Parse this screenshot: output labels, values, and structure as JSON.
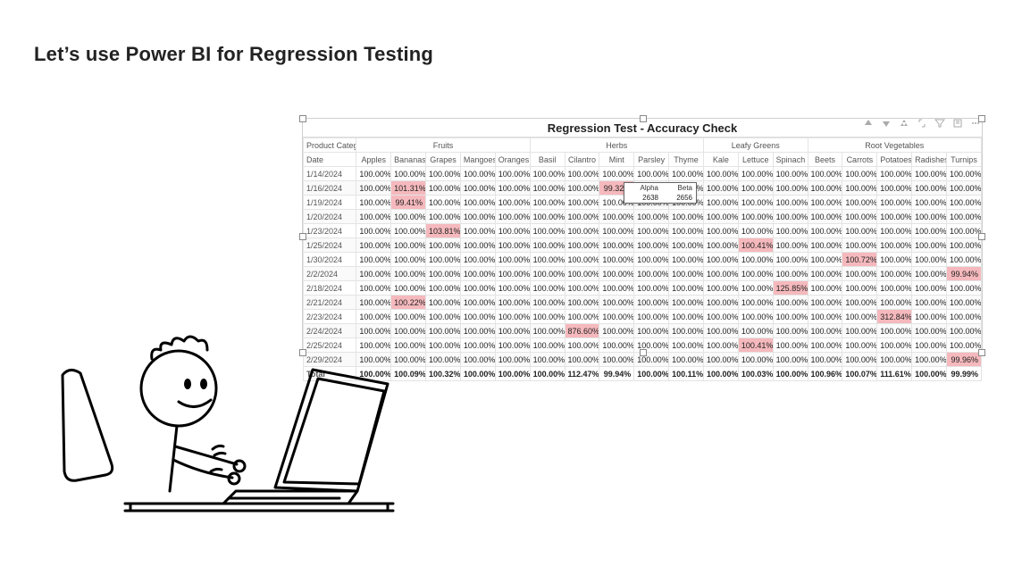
{
  "title": "Let’s use Power BI for Regression Testing",
  "visual": {
    "title": "Regression Test - Accuracy Check",
    "row_label_top": "Product Category",
    "row_label_sub": "Date",
    "groups": [
      {
        "name": "Fruits",
        "span": 5
      },
      {
        "name": "Herbs",
        "span": 5
      },
      {
        "name": "Leafy Greens",
        "span": 3
      },
      {
        "name": "Root Vegetables",
        "span": 5
      }
    ],
    "columns": [
      "Apples",
      "Bananas",
      "Grapes",
      "Mangoes",
      "Oranges",
      "Basil",
      "Cilantro",
      "Mint",
      "Parsley",
      "Thyme",
      "Kale",
      "Lettuce",
      "Spinach",
      "Beets",
      "Carrots",
      "Potatoes",
      "Radishes",
      "Turnips"
    ],
    "rows": [
      {
        "date": "1/14/2024",
        "vals": [
          "100.00%",
          "100.00%",
          "100.00%",
          "100.00%",
          "100.00%",
          "100.00%",
          "100.00%",
          "100.00%",
          "100.00%",
          "100.00%",
          "100.00%",
          "100.00%",
          "100.00%",
          "100.00%",
          "100.00%",
          "100.00%",
          "100.00%",
          "100.00%"
        ],
        "hl": []
      },
      {
        "date": "1/16/2024",
        "vals": [
          "100.00%",
          "101.31%",
          "100.00%",
          "100.00%",
          "100.00%",
          "100.00%",
          "100.00%",
          "99.32%",
          "100.00%",
          "100.00%",
          "100.00%",
          "100.00%",
          "100.00%",
          "100.00%",
          "100.00%",
          "100.00%",
          "100.00%",
          "100.00%"
        ],
        "hl": [
          1,
          7
        ]
      },
      {
        "date": "1/19/2024",
        "vals": [
          "100.00%",
          "99.41%",
          "100.00%",
          "100.00%",
          "100.00%",
          "100.00%",
          "100.00%",
          "100.00%",
          "100.00%",
          "100.00%",
          "100.00%",
          "100.00%",
          "100.00%",
          "100.00%",
          "100.00%",
          "100.00%",
          "100.00%",
          "100.00%"
        ],
        "hl": [
          1
        ]
      },
      {
        "date": "1/20/2024",
        "vals": [
          "100.00%",
          "100.00%",
          "100.00%",
          "100.00%",
          "100.00%",
          "100.00%",
          "100.00%",
          "100.00%",
          "100.00%",
          "100.00%",
          "100.00%",
          "100.00%",
          "100.00%",
          "100.00%",
          "100.00%",
          "100.00%",
          "100.00%",
          "100.00%"
        ],
        "hl": []
      },
      {
        "date": "1/23/2024",
        "vals": [
          "100.00%",
          "100.00%",
          "103.81%",
          "100.00%",
          "100.00%",
          "100.00%",
          "100.00%",
          "100.00%",
          "100.00%",
          "100.00%",
          "100.00%",
          "100.00%",
          "100.00%",
          "100.00%",
          "100.00%",
          "100.00%",
          "100.00%",
          "100.00%"
        ],
        "hl": [
          2
        ]
      },
      {
        "date": "1/25/2024",
        "vals": [
          "100.00%",
          "100.00%",
          "100.00%",
          "100.00%",
          "100.00%",
          "100.00%",
          "100.00%",
          "100.00%",
          "100.00%",
          "100.00%",
          "100.00%",
          "100.41%",
          "100.00%",
          "100.00%",
          "100.00%",
          "100.00%",
          "100.00%",
          "100.00%"
        ],
        "hl": [
          11
        ]
      },
      {
        "date": "1/30/2024",
        "vals": [
          "100.00%",
          "100.00%",
          "100.00%",
          "100.00%",
          "100.00%",
          "100.00%",
          "100.00%",
          "100.00%",
          "100.00%",
          "100.00%",
          "100.00%",
          "100.00%",
          "100.00%",
          "100.00%",
          "100.72%",
          "100.00%",
          "100.00%",
          "100.00%"
        ],
        "hl": [
          14
        ]
      },
      {
        "date": "2/2/2024",
        "vals": [
          "100.00%",
          "100.00%",
          "100.00%",
          "100.00%",
          "100.00%",
          "100.00%",
          "100.00%",
          "100.00%",
          "100.00%",
          "100.00%",
          "100.00%",
          "100.00%",
          "100.00%",
          "100.00%",
          "100.00%",
          "100.00%",
          "100.00%",
          "99.94%"
        ],
        "hl": [
          17
        ]
      },
      {
        "date": "2/18/2024",
        "vals": [
          "100.00%",
          "100.00%",
          "100.00%",
          "100.00%",
          "100.00%",
          "100.00%",
          "100.00%",
          "100.00%",
          "100.00%",
          "100.00%",
          "100.00%",
          "100.00%",
          "125.85%",
          "100.00%",
          "100.00%",
          "100.00%",
          "100.00%",
          "100.00%"
        ],
        "hl": [
          12
        ]
      },
      {
        "date": "2/21/2024",
        "vals": [
          "100.00%",
          "100.22%",
          "100.00%",
          "100.00%",
          "100.00%",
          "100.00%",
          "100.00%",
          "100.00%",
          "100.00%",
          "100.00%",
          "100.00%",
          "100.00%",
          "100.00%",
          "100.00%",
          "100.00%",
          "100.00%",
          "100.00%",
          "100.00%"
        ],
        "hl": [
          1
        ]
      },
      {
        "date": "2/23/2024",
        "vals": [
          "100.00%",
          "100.00%",
          "100.00%",
          "100.00%",
          "100.00%",
          "100.00%",
          "100.00%",
          "100.00%",
          "100.00%",
          "100.00%",
          "100.00%",
          "100.00%",
          "100.00%",
          "100.00%",
          "100.00%",
          "312.84%",
          "100.00%",
          "100.00%"
        ],
        "hl": [
          15
        ]
      },
      {
        "date": "2/24/2024",
        "vals": [
          "100.00%",
          "100.00%",
          "100.00%",
          "100.00%",
          "100.00%",
          "100.00%",
          "876.60%",
          "100.00%",
          "100.00%",
          "100.00%",
          "100.00%",
          "100.00%",
          "100.00%",
          "100.00%",
          "100.00%",
          "100.00%",
          "100.00%",
          "100.00%"
        ],
        "hl": [
          6
        ]
      },
      {
        "date": "2/25/2024",
        "vals": [
          "100.00%",
          "100.00%",
          "100.00%",
          "100.00%",
          "100.00%",
          "100.00%",
          "100.00%",
          "100.00%",
          "100.00%",
          "100.00%",
          "100.00%",
          "100.41%",
          "100.00%",
          "100.00%",
          "100.00%",
          "100.00%",
          "100.00%",
          "100.00%"
        ],
        "hl": [
          11
        ]
      },
      {
        "date": "2/29/2024",
        "vals": [
          "100.00%",
          "100.00%",
          "100.00%",
          "100.00%",
          "100.00%",
          "100.00%",
          "100.00%",
          "100.00%",
          "100.00%",
          "100.00%",
          "100.00%",
          "100.00%",
          "100.00%",
          "100.00%",
          "100.00%",
          "100.00%",
          "100.00%",
          "99.96%"
        ],
        "hl": [
          17
        ]
      }
    ],
    "total": {
      "label": "Total",
      "vals": [
        "100.00%",
        "100.09%",
        "100.32%",
        "100.00%",
        "100.00%",
        "100.00%",
        "112.47%",
        "99.94%",
        "100.00%",
        "100.11%",
        "100.00%",
        "100.03%",
        "100.00%",
        "100.96%",
        "100.07%",
        "111.61%",
        "100.00%",
        "99.99%"
      ]
    }
  },
  "tooltip": {
    "headers": [
      "Alpha",
      "Beta"
    ],
    "values": [
      "2638",
      "2656"
    ]
  },
  "toolbar_icons": [
    "drill-up",
    "drill-down",
    "drill-hierarchy",
    "expand",
    "filter",
    "focus-mode",
    "more"
  ]
}
